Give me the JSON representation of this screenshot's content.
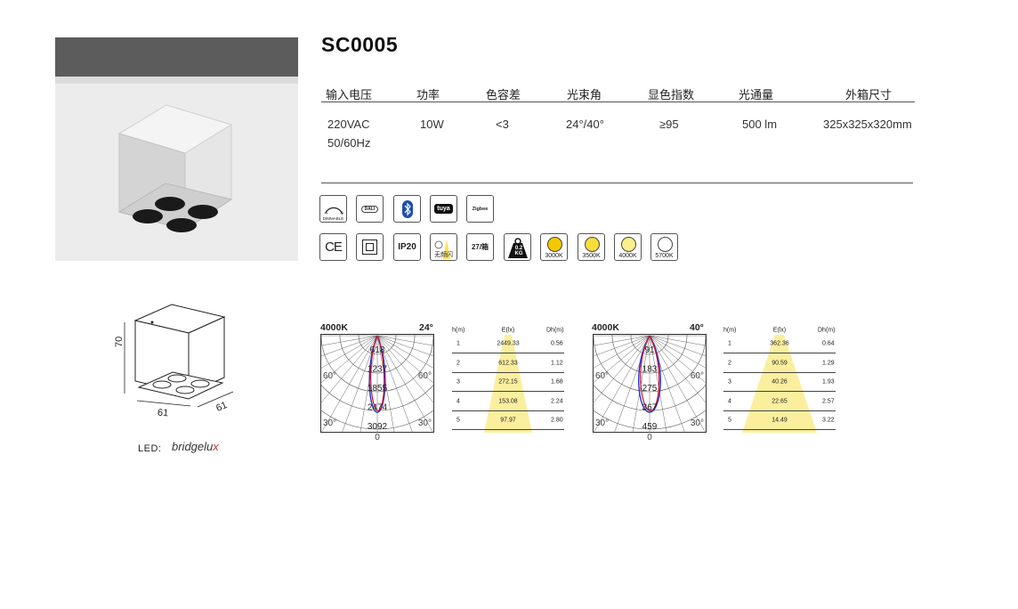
{
  "product": {
    "code": "SC0005"
  },
  "specs": {
    "headers": [
      "输入电压",
      "功率",
      "色容差",
      "光束角",
      "显色指数",
      "光通量",
      "外箱尺寸"
    ],
    "values": [
      [
        "220VAC",
        "50/60Hz"
      ],
      [
        "10W"
      ],
      [
        "<3"
      ],
      [
        "24°/40°"
      ],
      [
        "≥95"
      ],
      [
        "500 lm"
      ],
      [
        "325x325x320mm"
      ]
    ]
  },
  "feature_icons": {
    "row1": [
      {
        "icon": "dimmable-icon",
        "label": "DIMMABLE"
      },
      {
        "icon": "dali-icon",
        "label": "DALI"
      },
      {
        "icon": "bluetooth-icon",
        "label": ""
      },
      {
        "icon": "tuya-icon",
        "label": "tuya"
      },
      {
        "icon": "zigbee-icon",
        "label": "Zigbee"
      }
    ],
    "row2": [
      {
        "icon": "ce-icon",
        "label": "CE"
      },
      {
        "icon": "class-ii-icon",
        "label": ""
      },
      {
        "icon": "ip-rating-icon",
        "label": "IP20"
      },
      {
        "icon": "no-flicker-icon",
        "label": "无频闪"
      },
      {
        "icon": "box-qty-icon",
        "label": "27/箱"
      },
      {
        "icon": "weight-icon",
        "label": "0.2 KG"
      },
      {
        "icon": "cct-3000k-icon",
        "label": "3000K",
        "color": "#f5c800"
      },
      {
        "icon": "cct-3500k-icon",
        "label": "3500K",
        "color": "#f7dc3c"
      },
      {
        "icon": "cct-4000k-icon",
        "label": "4000K",
        "color": "#fbee8c"
      },
      {
        "icon": "cct-5700k-icon",
        "label": "5700K",
        "color": "#ffffff"
      }
    ]
  },
  "dimensions": {
    "height": "70",
    "width": "61",
    "depth": "61"
  },
  "led": {
    "label": "LED:",
    "brand_main": "bridgelu",
    "brand_accent": "x"
  },
  "photometrics": [
    {
      "cct": "4000K",
      "beam": "24°",
      "polar_labels": [
        "618",
        "1237",
        "1855",
        "2474",
        "3092"
      ],
      "angle_labels": [
        "60°",
        "60°",
        "30°",
        "30°",
        "0"
      ],
      "table": {
        "headers": [
          "h(m)",
          "E(lx)",
          "Dh(m)"
        ],
        "rows": [
          [
            "1",
            "2449.33",
            "0.56"
          ],
          [
            "2",
            "612.33",
            "1.12"
          ],
          [
            "3",
            "272.15",
            "1.68"
          ],
          [
            "4",
            "153.08",
            "2.24"
          ],
          [
            "5",
            "97.97",
            "2.80"
          ]
        ]
      }
    },
    {
      "cct": "4000K",
      "beam": "40°",
      "polar_labels": [
        "91",
        "183",
        "275",
        "367",
        "459"
      ],
      "angle_labels": [
        "60°",
        "60°",
        "30°",
        "30°",
        "0"
      ],
      "table": {
        "headers": [
          "h(m)",
          "E(lx)",
          "Dh(m)"
        ],
        "rows": [
          [
            "1",
            "362.36",
            "0.64"
          ],
          [
            "2",
            "90.59",
            "1.29"
          ],
          [
            "3",
            "40.26",
            "1.93"
          ],
          [
            "4",
            "22.65",
            "2.57"
          ],
          [
            "5",
            "14.49",
            "3.22"
          ]
        ]
      }
    }
  ],
  "colors": {
    "accent_yellow": "#fbef9e",
    "curve_blue": "#2233cc",
    "curve_red": "#cc1133"
  }
}
